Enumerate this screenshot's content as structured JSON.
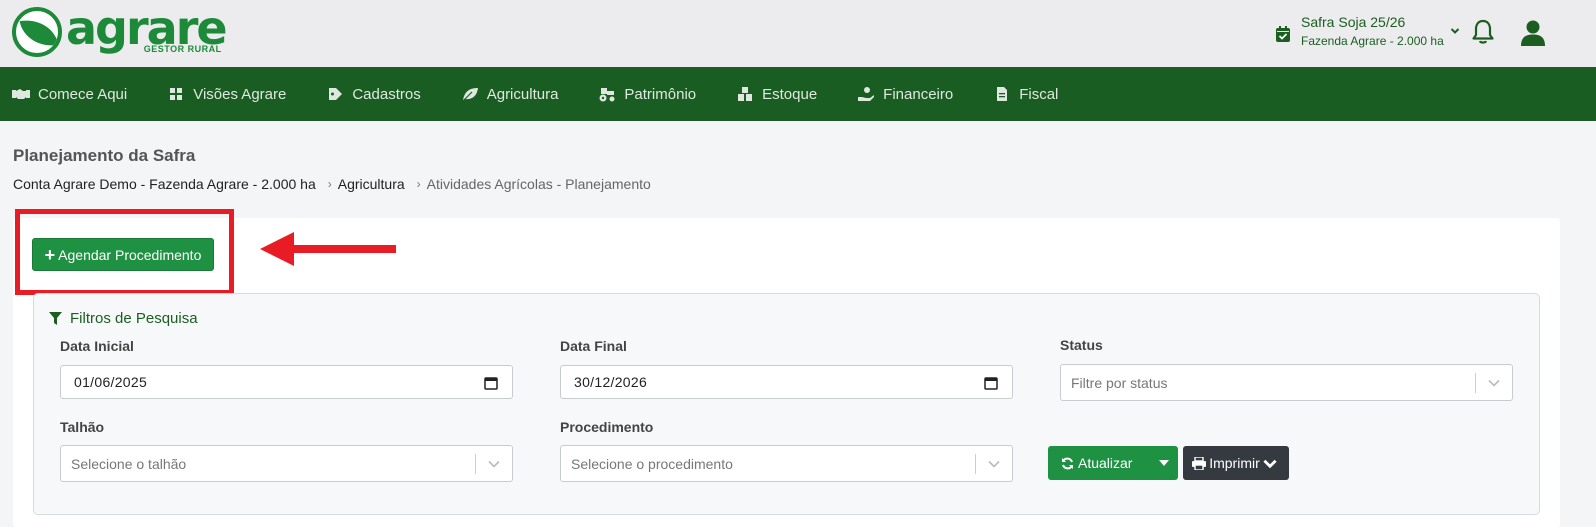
{
  "header": {
    "logo_text": "agrare",
    "logo_subtext": "GESTOR RURAL",
    "safra_title": "Safra Soja 25/26",
    "safra_subtitle": "Fazenda Agrare - 2.000 ha"
  },
  "nav": {
    "items": [
      {
        "label": "Comece Aqui",
        "icon": "handshake-icon"
      },
      {
        "label": "Visões Agrare",
        "icon": "dashboard-icon"
      },
      {
        "label": "Cadastros",
        "icon": "tag-icon"
      },
      {
        "label": "Agricultura",
        "icon": "leaf-icon"
      },
      {
        "label": "Patrimônio",
        "icon": "tractor-icon"
      },
      {
        "label": "Estoque",
        "icon": "boxes-icon"
      },
      {
        "label": "Financeiro",
        "icon": "hand-coin-icon"
      },
      {
        "label": "Fiscal",
        "icon": "invoice-icon"
      }
    ]
  },
  "page": {
    "title": "Planejamento da Safra",
    "breadcrumb": [
      "Conta Agrare Demo - Fazenda Agrare - 2.000 ha",
      "Agricultura",
      "Atividades Agrícolas - Planejamento"
    ]
  },
  "actions": {
    "agendar_label": "Agendar Procedimento"
  },
  "filters": {
    "title": "Filtros de Pesquisa",
    "data_inicial_label": "Data Inicial",
    "data_inicial_value": "01/06/2025",
    "data_final_label": "Data Final",
    "data_final_value": "30/12/2026",
    "status_label": "Status",
    "status_placeholder": "Filtre por status",
    "talhao_label": "Talhão",
    "talhao_placeholder": "Selecione o talhão",
    "procedimento_label": "Procedimento",
    "procedimento_placeholder": "Selecione o procedimento",
    "atualizar_label": "Atualizar",
    "imprimir_label": "Imprimir"
  },
  "colors": {
    "brand_green": "#1d8a3a",
    "nav_bg": "#1a5d22",
    "button_green": "#1e9142",
    "button_dark": "#343a40",
    "annotation_red": "#e81c24"
  }
}
